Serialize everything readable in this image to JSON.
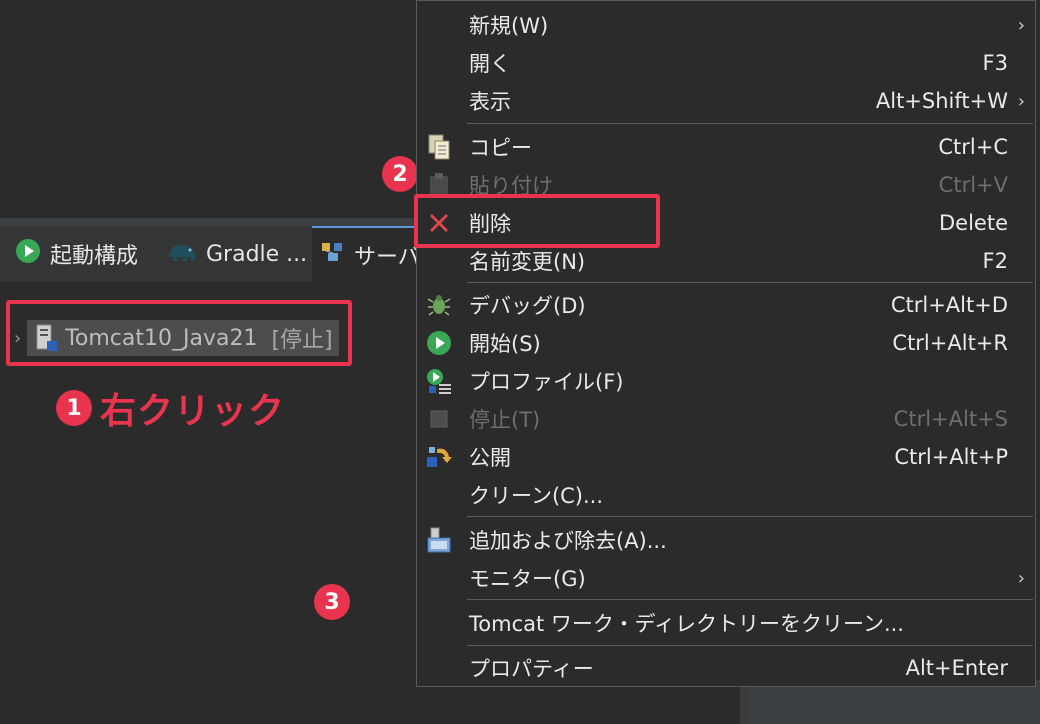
{
  "tabs": [
    {
      "label": "起動構成",
      "icon": "run-icon"
    },
    {
      "label": "Gradle ...",
      "icon": "gradle-elephant-icon"
    },
    {
      "label": "サーバ",
      "icon": "servers-icon"
    }
  ],
  "server": {
    "name": "Tomcat10_Java21",
    "state": "[停止]",
    "icon": "server-icon"
  },
  "annotations": {
    "step1": "1",
    "step1_text": "右クリック",
    "step2": "2",
    "step3": "3",
    "color": "#e8344e"
  },
  "menu": {
    "items": [
      {
        "label": "新規(W)",
        "accel": "",
        "submenu": true
      },
      {
        "label": "開く",
        "accel": "F3"
      },
      {
        "label": "表示",
        "accel": "Alt+Shift+W",
        "submenu": true
      },
      {
        "label": "コピー",
        "accel": "Ctrl+C",
        "icon": "copy-icon"
      },
      {
        "label": "貼り付け",
        "accel": "Ctrl+V",
        "icon": "paste-icon",
        "disabled": true
      },
      {
        "label": "削除",
        "accel": "Delete",
        "icon": "delete-icon"
      },
      {
        "label": "名前変更(N)",
        "accel": "F2"
      },
      {
        "label": "デバッグ(D)",
        "accel": "Ctrl+Alt+D",
        "icon": "debug-icon"
      },
      {
        "label": "開始(S)",
        "accel": "Ctrl+Alt+R",
        "icon": "start-icon"
      },
      {
        "label": "プロファイル(F)",
        "accel": "",
        "icon": "profile-icon"
      },
      {
        "label": "停止(T)",
        "accel": "Ctrl+Alt+S",
        "icon": "stop-icon",
        "disabled": true
      },
      {
        "label": "公開",
        "accel": "Ctrl+Alt+P",
        "icon": "publish-icon"
      },
      {
        "label": "クリーン(C)...",
        "accel": ""
      },
      {
        "label": "追加および除去(A)...",
        "accel": "",
        "icon": "add-remove-icon"
      },
      {
        "label": "モニター(G)",
        "accel": "",
        "submenu": true
      },
      {
        "label": "Tomcat ワーク・ディレクトリーをクリーン...",
        "accel": ""
      },
      {
        "label": "プロパティー",
        "accel": "Alt+Enter"
      }
    ]
  }
}
